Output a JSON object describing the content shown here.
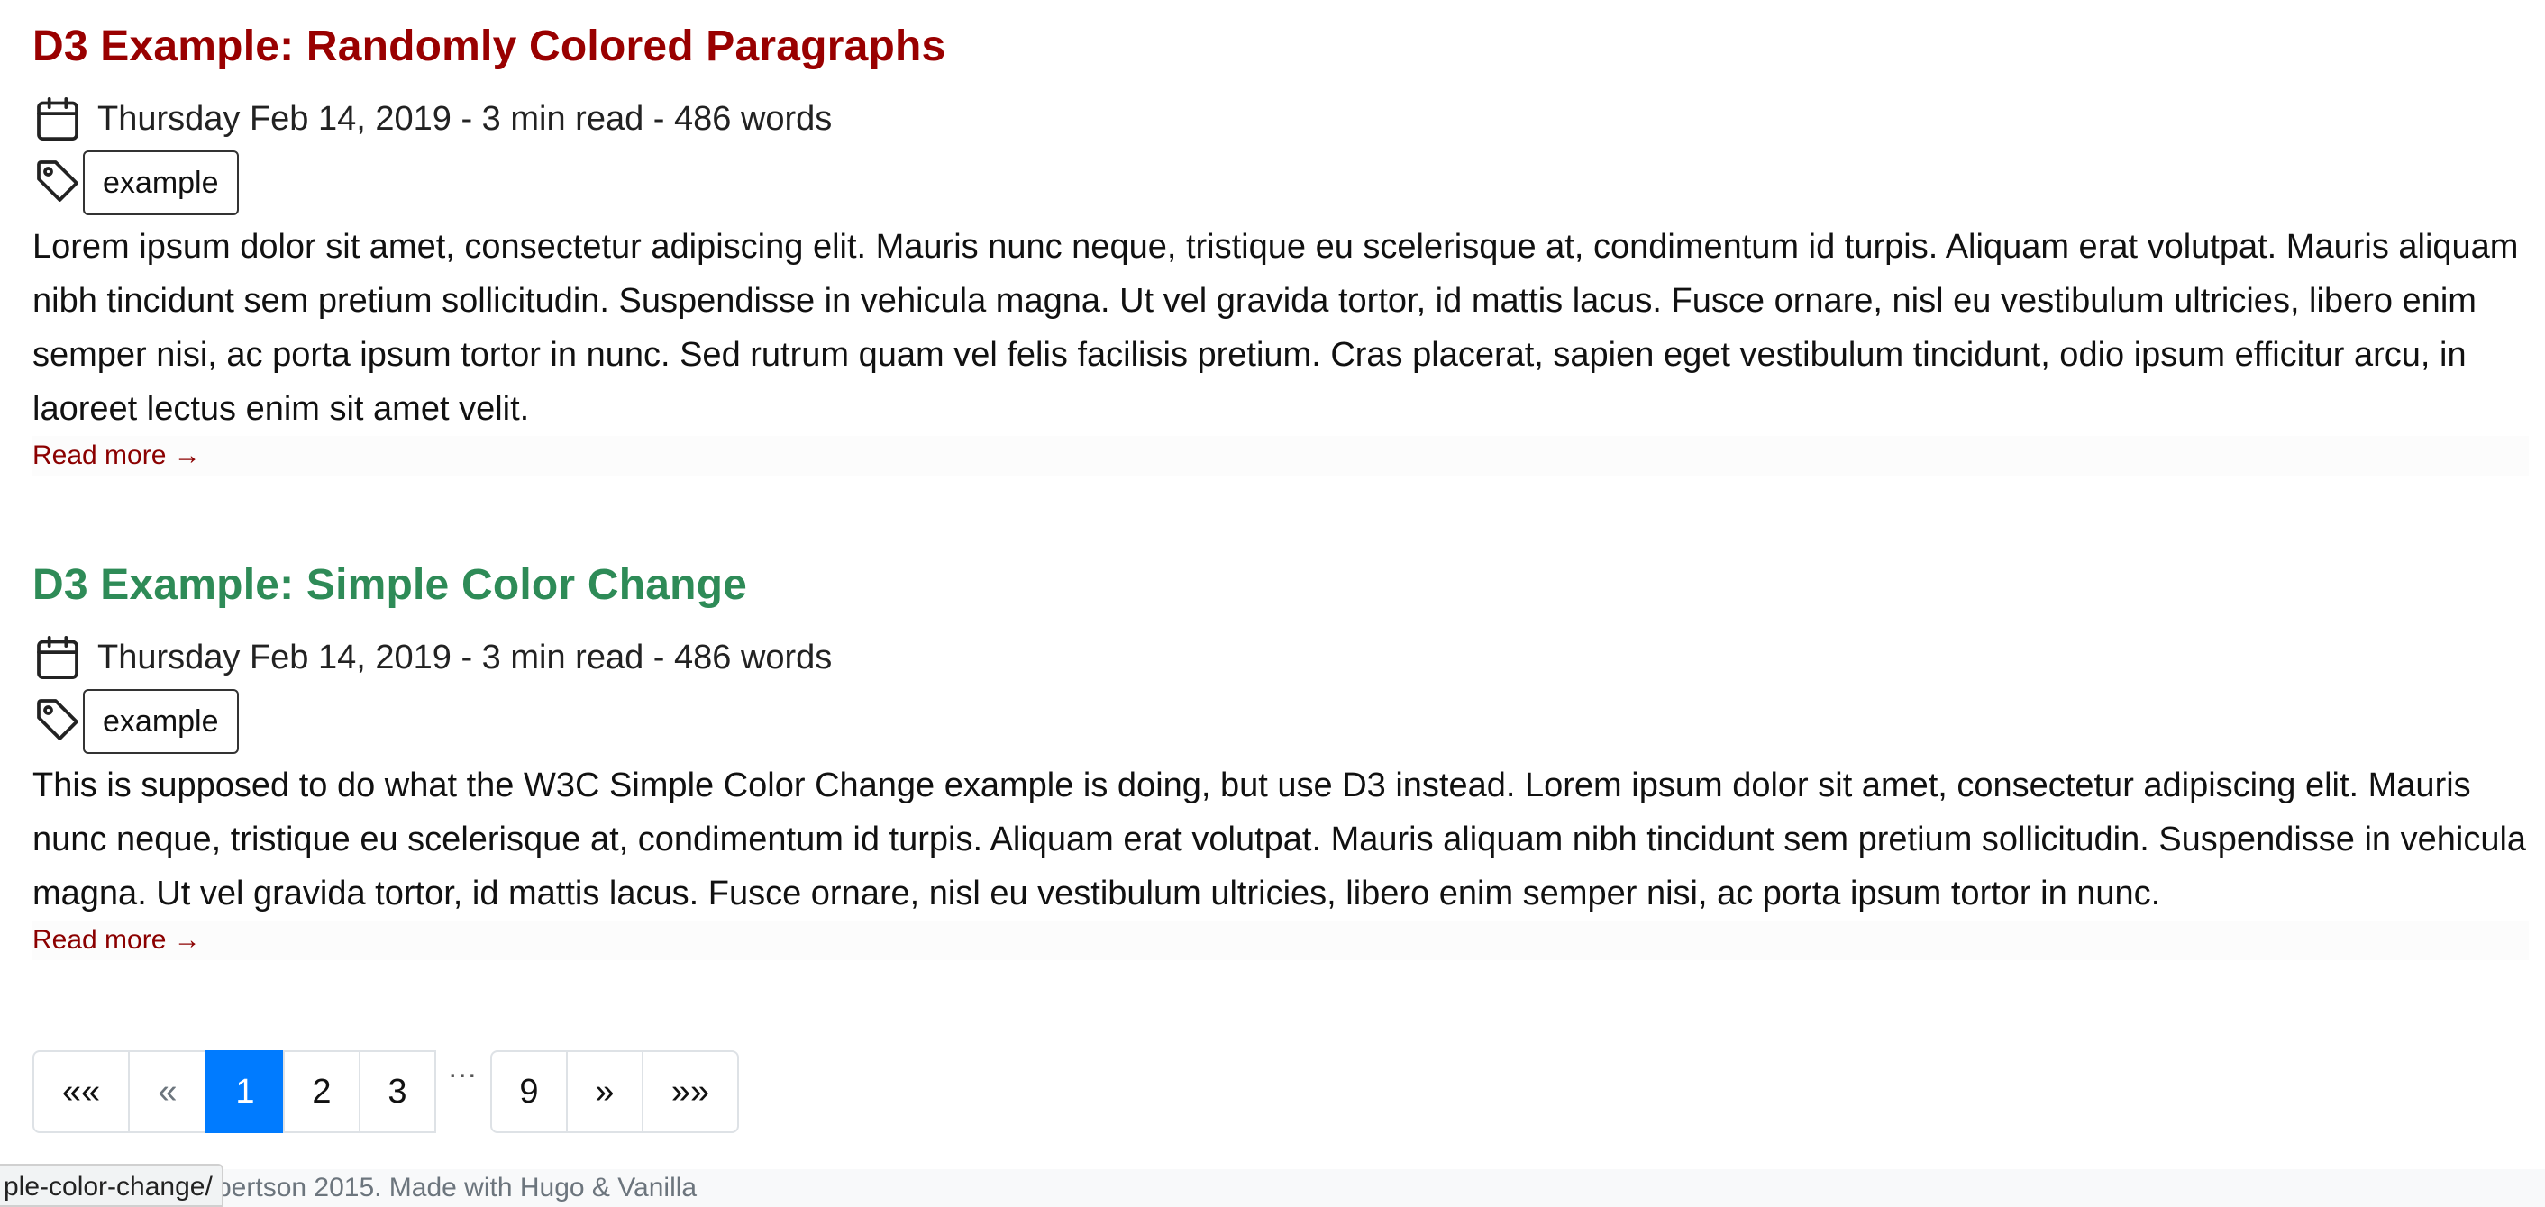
{
  "posts": [
    {
      "title": "D3 Example: Randomly Colored Paragraphs",
      "title_color": "#990000",
      "meta": "Thursday Feb 14, 2019 - 3 min read - 486 words",
      "tag": "example",
      "summary": "Lorem ipsum dolor sit amet, consectetur adipiscing elit. Mauris nunc neque, tristique eu scelerisque at, condimentum id turpis. Aliquam erat volutpat. Mauris aliquam nibh tincidunt sem pretium sollicitudin. Suspendisse in vehicula magna. Ut vel gravida tortor, id mattis lacus. Fusce ornare, nisl eu vestibulum ultricies, libero enim semper nisi, ac porta ipsum tortor in nunc. Sed rutrum quam vel felis facilisis pretium. Cras placerat, sapien eget vestibulum tincidunt, odio ipsum efficitur arcu, in laoreet lectus enim sit amet velit.",
      "read_more": "Read more →"
    },
    {
      "title": "D3 Example: Simple Color Change",
      "title_color": "#2e8b57",
      "meta": "Thursday Feb 14, 2019 - 3 min read - 486 words",
      "tag": "example",
      "summary": "This is supposed to do what the W3C Simple Color Change example is doing, but use D3 instead. Lorem ipsum dolor sit amet, consectetur adipiscing elit. Mauris nunc neque, tristique eu scelerisque at, condimentum id turpis. Aliquam erat volutpat. Mauris aliquam nibh tincidunt sem pretium sollicitudin. Suspendisse in vehicula magna. Ut vel gravida tortor, id mattis lacus. Fusce ornare, nisl eu vestibulum ultricies, libero enim semper nisi, ac porta ipsum tortor in nunc.",
      "read_more": "Read more →"
    }
  ],
  "icons": {
    "date": "calendar-icon",
    "tags": "tag-icon"
  },
  "pagination": {
    "first": "«‹«",
    "prev": "«",
    "pages": [
      "1",
      "2",
      "3"
    ],
    "ellipsis": "…",
    "last_page": "9",
    "next": "»",
    "last": "»»",
    "active_page": "1",
    "active_color": "#007bff"
  },
  "footer": {
    "text": "bertson 2015. Made with Hugo & Vanilla"
  },
  "status_url": "ple-color-change/"
}
